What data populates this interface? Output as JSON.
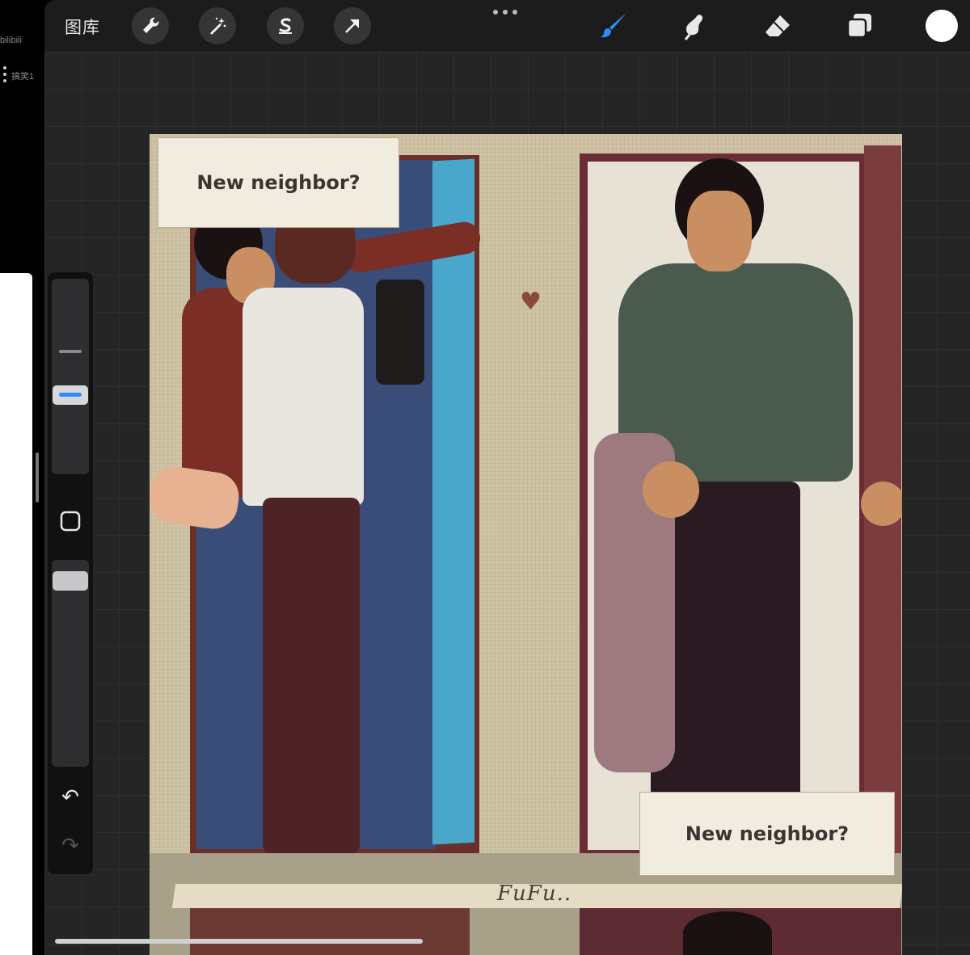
{
  "left_strip": {
    "top_text": "bilibili",
    "side_text": "搞笑1"
  },
  "toolbar": {
    "gallery_label": "图库",
    "tools": [
      {
        "name": "wrench-icon"
      },
      {
        "name": "magic-wand-icon"
      },
      {
        "name": "selection-icon"
      },
      {
        "name": "transform-arrow-icon"
      }
    ],
    "right_tools": [
      {
        "name": "brush-icon",
        "active": true
      },
      {
        "name": "smudge-icon"
      },
      {
        "name": "eraser-icon"
      },
      {
        "name": "layers-icon"
      }
    ],
    "current_color": "#ffffff",
    "accent_color": "#2f8cff"
  },
  "sidebar": {
    "undo_label": "↶",
    "redo_label": "↷",
    "brush_size_level": 0.6,
    "opacity_level": 1.0
  },
  "artwork": {
    "caption_top": "New neighbor?",
    "caption_bottom": "New neighbor?",
    "signature": "FuFu..",
    "heart": "♥"
  }
}
